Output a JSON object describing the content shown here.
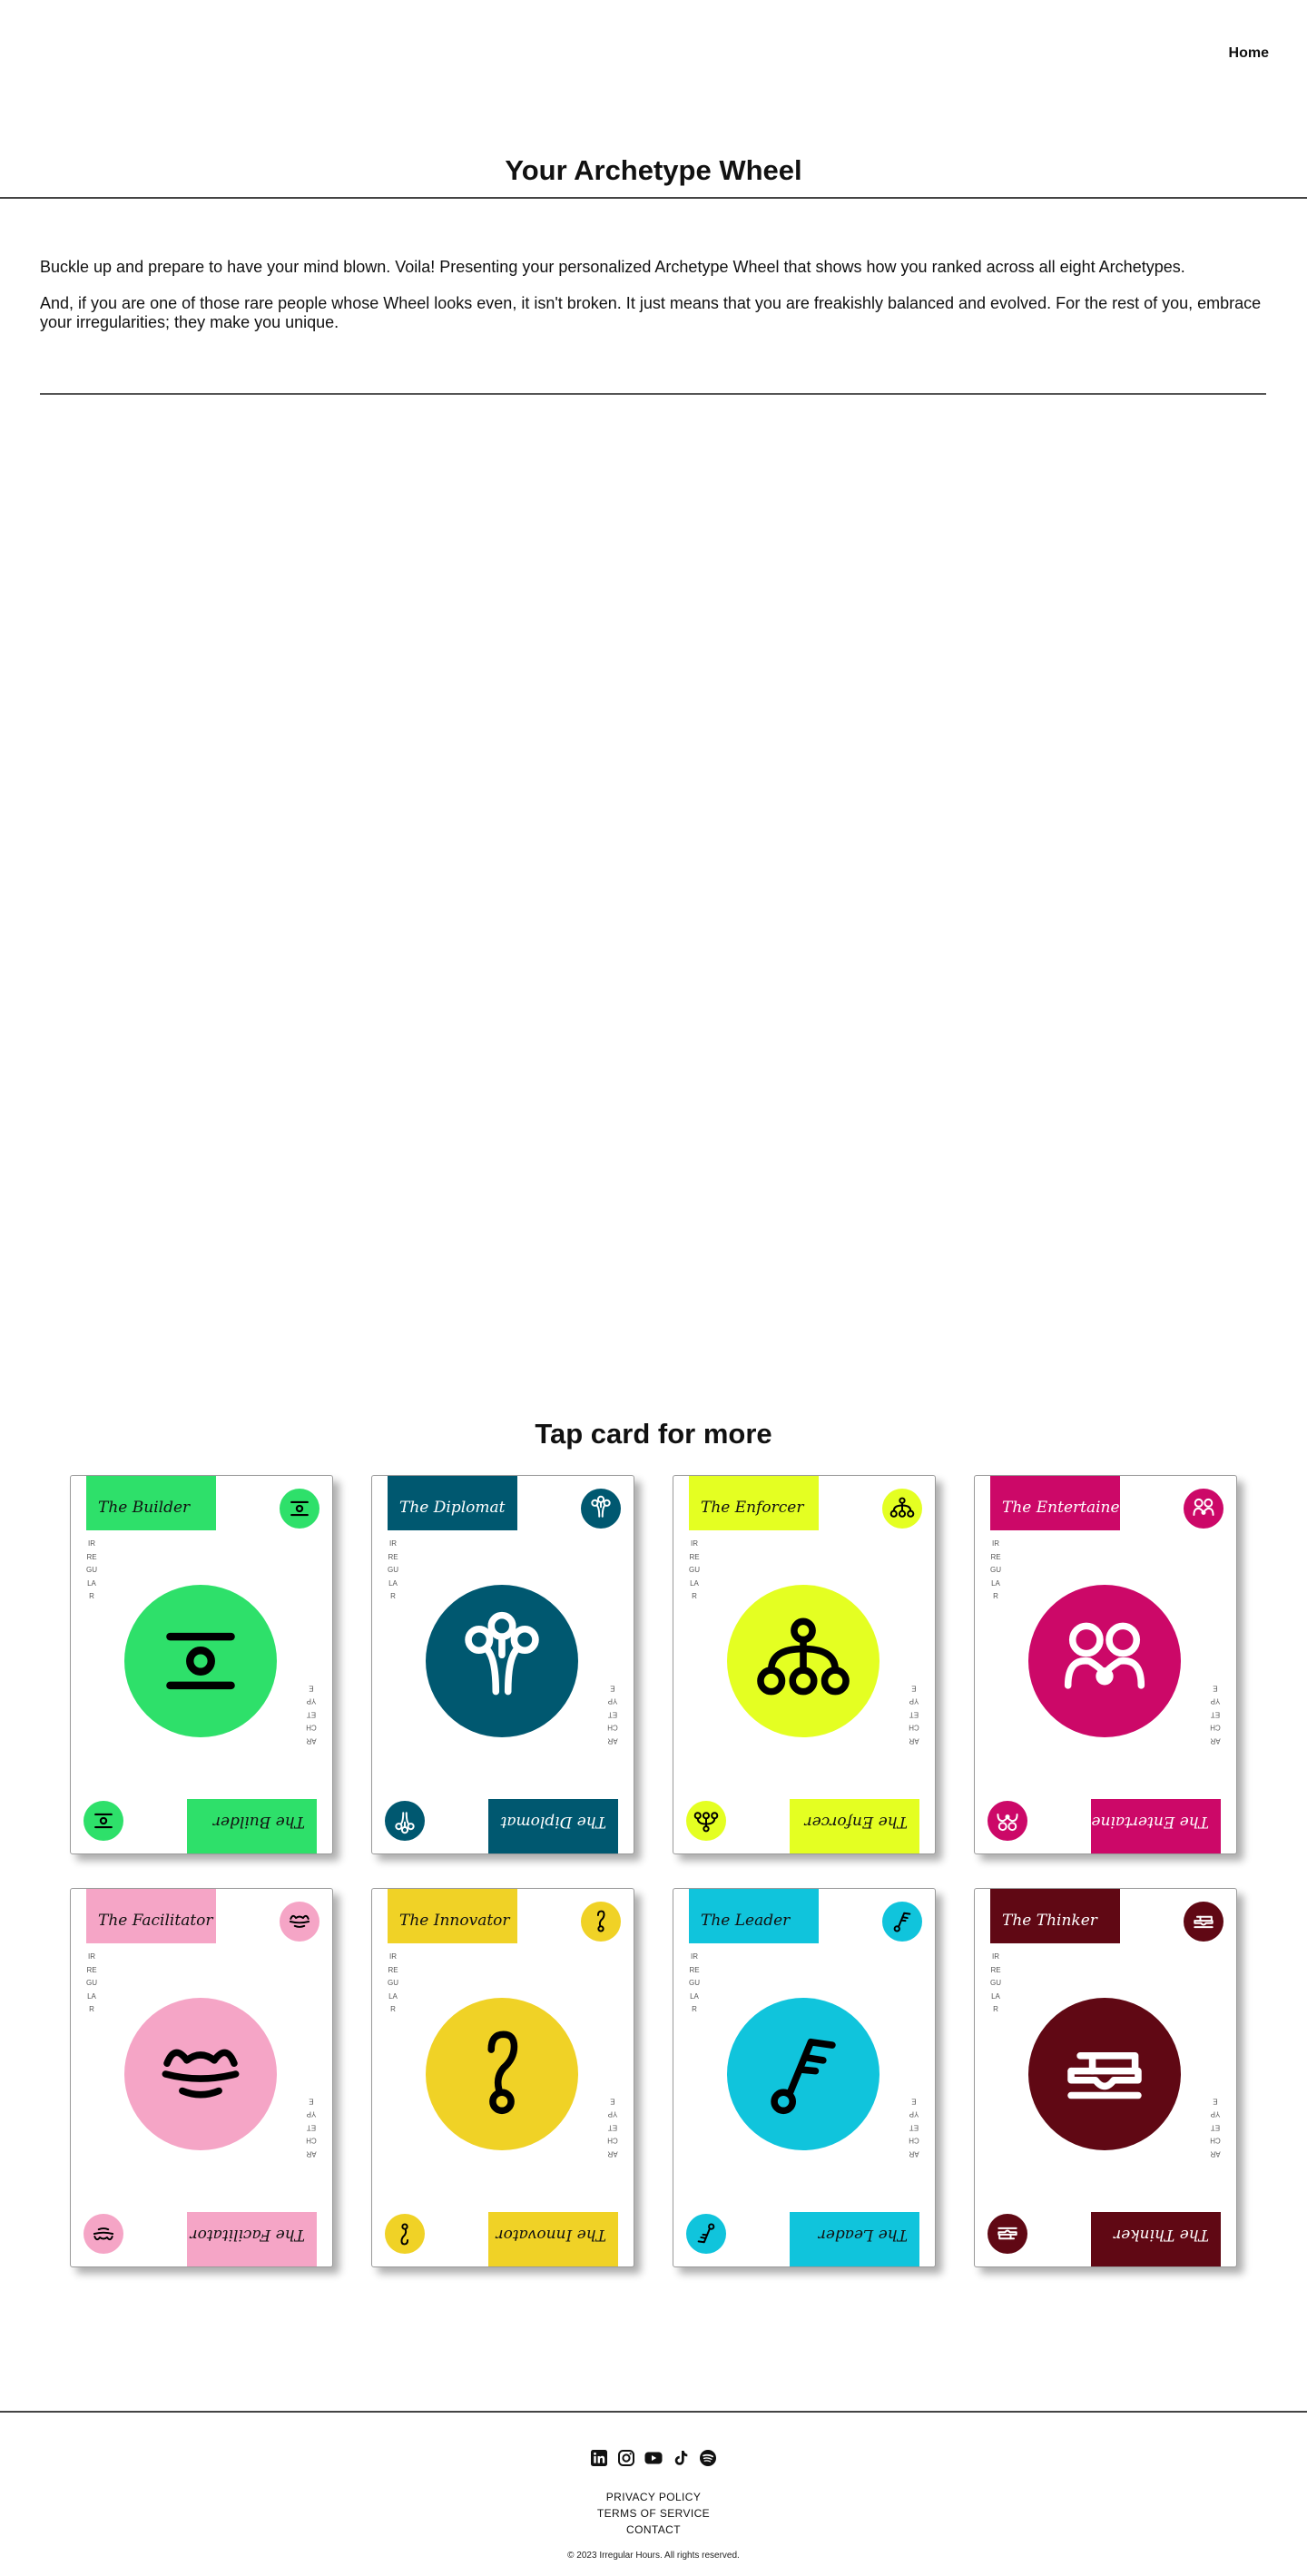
{
  "nav": {
    "home_label": "Home"
  },
  "header": {
    "title": "Your Archetype Wheel"
  },
  "intro": {
    "paragraph_1": "Buckle up and prepare to have your mind blown. Voila! Presenting your personalized Archetype Wheel that shows how you ranked across all eight Archetypes.",
    "paragraph_2": "And, if you are one of those rare people whose Wheel looks even, it isn't broken. It just means that you are freakishly balanced and evolved. For the rest of you, embrace your irregularities; they make you unique."
  },
  "cards_section": {
    "title": "Tap card for more",
    "vertical_text_left": "IRREGULAR",
    "vertical_text_right": "ARCHETYPE",
    "cards": [
      {
        "name": "The Builder",
        "color": "#2ee06a",
        "symbol_color": "#000000",
        "label_color": "#111111",
        "icon": "builder-icon"
      },
      {
        "name": "The Diplomat",
        "color": "#005870",
        "symbol_color": "#ffffff",
        "label_color": "#ffffff",
        "icon": "diplomat-icon"
      },
      {
        "name": "The Enforcer",
        "color": "#e4ff22",
        "symbol_color": "#000000",
        "label_color": "#111111",
        "icon": "enforcer-icon"
      },
      {
        "name": "The Entertainer",
        "color": "#cc0868",
        "symbol_color": "#ffffff",
        "label_color": "#ffffff",
        "icon": "entertainer-icon"
      },
      {
        "name": "The Facilitator",
        "color": "#f5a5c6",
        "symbol_color": "#000000",
        "label_color": "#111111",
        "icon": "facilitator-icon"
      },
      {
        "name": "The Innovator",
        "color": "#f0d226",
        "symbol_color": "#000000",
        "label_color": "#111111",
        "icon": "innovator-icon"
      },
      {
        "name": "The Leader",
        "color": "#10c4dc",
        "symbol_color": "#000000",
        "label_color": "#111111",
        "icon": "leader-icon"
      },
      {
        "name": "The Thinker",
        "color": "#600814",
        "symbol_color": "#ffffff",
        "label_color": "#ffffff",
        "icon": "thinker-icon"
      }
    ]
  },
  "footer": {
    "social_icons": [
      "linkedin-icon",
      "instagram-icon",
      "youtube-icon",
      "tiktok-icon",
      "spotify-icon"
    ],
    "links": [
      "PRIVACY POLICY",
      "TERMS OF SERVICE",
      "CONTACT"
    ],
    "copyright": "© 2023 Irregular Hours. All rights reserved."
  }
}
